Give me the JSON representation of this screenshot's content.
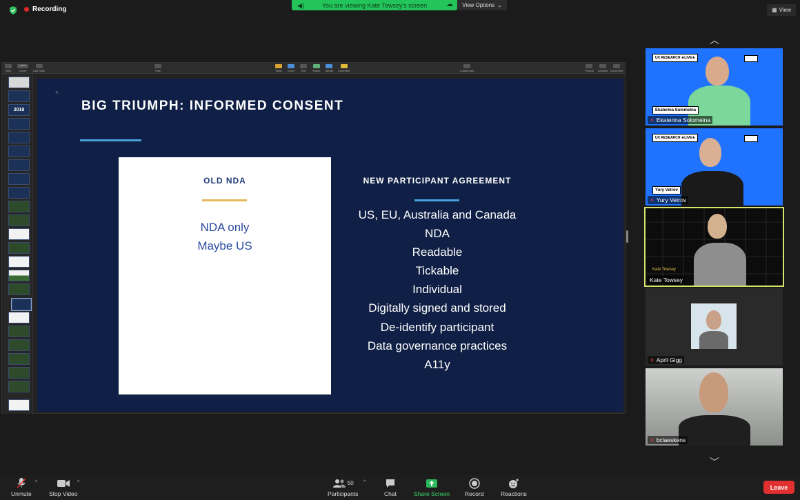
{
  "top": {
    "recording_label": "Recording",
    "viewing_banner": "You are viewing Kate Towsey's screen",
    "view_options": "View Options",
    "view_button": "View"
  },
  "keynote": {
    "toolbar": {
      "view": "View",
      "zoom": "Zoom",
      "add_slide": "Add Slide",
      "play": "Play",
      "table": "Table",
      "chart": "Chart",
      "text": "Text",
      "shape": "Shape",
      "media": "Media",
      "comment": "Comment",
      "collaborate": "Collaborate",
      "format": "Format",
      "animate": "Animate",
      "document": "Document",
      "zoom_value": "135%"
    },
    "thumb_year": "2019",
    "slide": {
      "title": "BIG TRIUMPH: INFORMED CONSENT",
      "old_heading": "OLD NDA",
      "old_items": [
        "NDA only",
        "Maybe US"
      ],
      "new_heading": "NEW PARTICIPANT AGREEMENT",
      "new_items": [
        "US, EU, Australia and Canada",
        "NDA",
        "Readable",
        "Tickable",
        "Individual",
        "Digitally signed and stored",
        "De-identify participant",
        "Data governance practices",
        "A11y"
      ]
    }
  },
  "participants": [
    {
      "name": "Ekaterina Solomeina",
      "badge": "UX RESEARCH ★LIVE★",
      "overlay": "Ekaterina Solomeina"
    },
    {
      "name": "Yury Vetrov",
      "badge": "UX RESEARCH ★LIVE★",
      "overlay": "Yury Vetrov"
    },
    {
      "name": "Kate Towsey",
      "overlay": "Kate Towsey"
    },
    {
      "name": "April Gigg"
    },
    {
      "name": "bclaeskens"
    }
  ],
  "controls": {
    "unmute": "Unmute",
    "stop_video": "Stop Video",
    "participants": "Participants",
    "participants_count": "50",
    "chat": "Chat",
    "share_screen": "Share Screen",
    "record": "Record",
    "reactions": "Reactions",
    "leave": "Leave"
  },
  "colors": {
    "slide_bg": "#0f1f45",
    "accent_blue": "#47a3d9",
    "accent_gold": "#e6b85a",
    "banner_green": "#23c55a",
    "leave_red": "#e03030",
    "active_speaker": "#d8e36a"
  }
}
